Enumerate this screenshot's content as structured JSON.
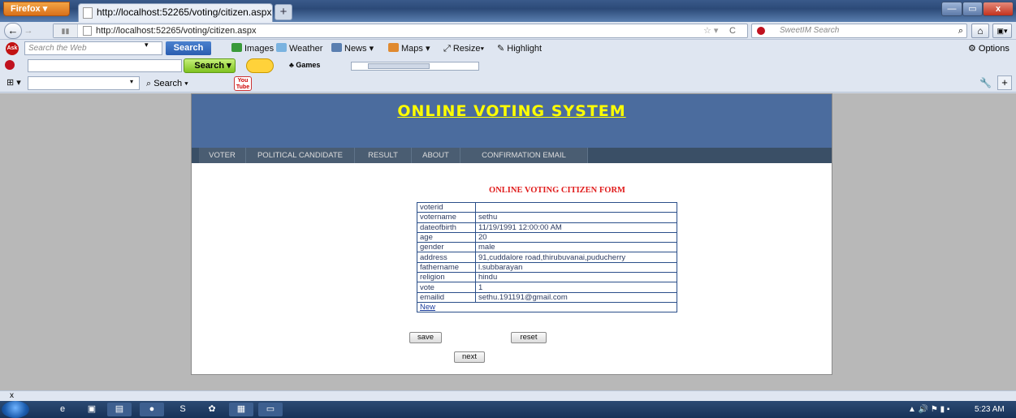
{
  "browser": {
    "menu_button": "Firefox",
    "tab_title": "http://localhost:52265/voting/citizen.aspx",
    "new_tab": "+",
    "url": "http://localhost:52265/voting/citizen.aspx",
    "search_placeholder": "SweetIM Search",
    "win_min": "—",
    "win_max": "▭",
    "win_close": "x"
  },
  "ask_toolbar": {
    "search_placeholder": "Search the Web",
    "search_button": "Search",
    "images": "Images",
    "weather": "Weather",
    "news": "News",
    "maps": "Maps",
    "resize": "Resize",
    "highlight": "Highlight",
    "options": "Options"
  },
  "sweetim_toolbar": {
    "search_button": "Search",
    "games": "Games"
  },
  "toolbar4": {
    "search": "Search",
    "youtube": "You Tube"
  },
  "site": {
    "title": "ONLINE VOTING SYSTEM",
    "menu": [
      "VOTER",
      "POLITICAL CANDIDATE",
      "RESULT",
      "ABOUT",
      "CONFIRMATION EMAIL"
    ]
  },
  "form": {
    "title": "ONLINE VOTING CITIZEN FORM",
    "rows": [
      {
        "key": "voterid",
        "value": ""
      },
      {
        "key": "votername",
        "value": "sethu"
      },
      {
        "key": "dateofbirth",
        "value": "11/19/1991 12:00:00 AM"
      },
      {
        "key": "age",
        "value": "20"
      },
      {
        "key": "gender",
        "value": "male"
      },
      {
        "key": "address",
        "value": "91,cuddalore road,thirubuvanai,puducherry"
      },
      {
        "key": "fathername",
        "value": "l.subbarayan"
      },
      {
        "key": "religion",
        "value": "hindu"
      },
      {
        "key": "vote",
        "value": "1"
      },
      {
        "key": "emailid",
        "value": "sethu.191191@gmail.com"
      }
    ],
    "new_link": "New",
    "save_button": "save",
    "reset_button": "reset",
    "next_button": "next"
  },
  "statusbar": {
    "close": "x"
  },
  "taskbar": {
    "time": "5:23 AM"
  },
  "colors": {
    "header_bg": "#4b6c9e",
    "title_color": "#ffff00",
    "menu_bg": "#3a4f66",
    "form_title": "#e01b1b",
    "table_border": "#2b4f8a"
  }
}
